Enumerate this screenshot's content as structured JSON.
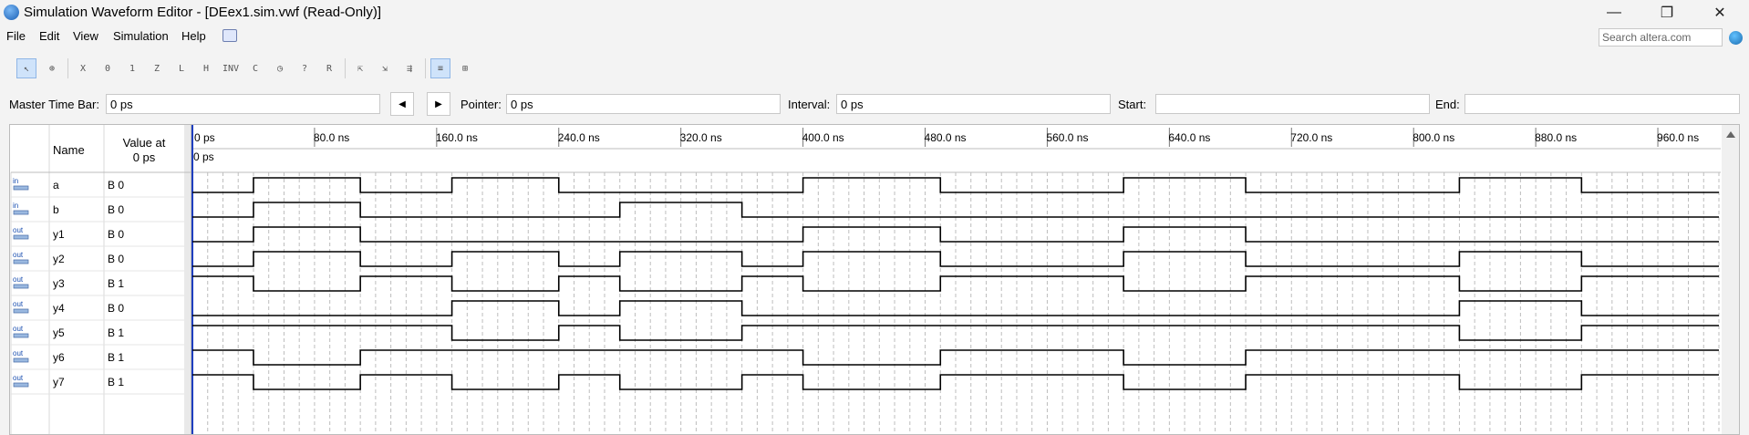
{
  "window": {
    "title": "Simulation Waveform Editor - [DEex1.sim.vwf (Read-Only)]",
    "controls": {
      "minimize": "—",
      "restore": "❐",
      "close": "✕"
    }
  },
  "menu": [
    "File",
    "Edit",
    "View",
    "Simulation",
    "Help"
  ],
  "search": {
    "placeholder": "Search altera.com"
  },
  "toolbar_icons": [
    "selection-tool",
    "zoom-tool",
    "forcing-unknown",
    "forcing-low",
    "forcing-high",
    "high-impedance",
    "weak-low",
    "weak-high",
    "invert",
    "count-value",
    "clock",
    "random-value",
    "arbitrary-value",
    "snap-to-grid",
    "sort",
    "group",
    "ungroup",
    "waveform-view"
  ],
  "timebar": {
    "master_label": "Master Time Bar:",
    "master_value": "0 ps",
    "pointer_label": "Pointer:",
    "pointer_value": "0 ps",
    "interval_label": "Interval:",
    "interval_value": "0 ps",
    "start_label": "Start:",
    "start_value": "",
    "end_label": "End:",
    "end_value": ""
  },
  "table": {
    "name_header": "Name",
    "value_header_1": "Value at",
    "value_header_2": "0 ps"
  },
  "axis": {
    "ticks": [
      "0 ps",
      "80.0 ns",
      "160.0 ns",
      "240.0 ns",
      "320.0 ns",
      "400.0 ns",
      "480.0 ns",
      "560.0 ns",
      "640.0 ns",
      "720.0 ns",
      "800.0 ns",
      "880.0 ns",
      "960.0 ns"
    ],
    "cursor_label": "0 ps",
    "range_ns": [
      0,
      1000
    ]
  },
  "signals": [
    {
      "name": "a",
      "dir": "in",
      "value": "B 0",
      "edges_ns": [
        0,
        40,
        110,
        170,
        240,
        400,
        490,
        610,
        690,
        830,
        910,
        1000
      ],
      "levels": [
        0,
        1,
        0,
        1,
        0,
        1,
        0,
        1,
        0,
        1,
        0
      ]
    },
    {
      "name": "b",
      "dir": "in",
      "value": "B 0",
      "edges_ns": [
        0,
        40,
        110,
        280,
        360,
        1000
      ],
      "levels": [
        0,
        1,
        0,
        1,
        0
      ]
    },
    {
      "name": "y1",
      "dir": "out",
      "value": "B 0",
      "edges_ns": [
        0,
        40,
        110,
        400,
        490,
        610,
        690,
        1000
      ],
      "levels": [
        0,
        1,
        0,
        1,
        0,
        1,
        0
      ]
    },
    {
      "name": "y2",
      "dir": "out",
      "value": "B 0",
      "edges_ns": [
        0,
        40,
        110,
        170,
        240,
        280,
        360,
        400,
        490,
        610,
        690,
        830,
        910,
        1000
      ],
      "levels": [
        0,
        1,
        0,
        1,
        0,
        1,
        0,
        1,
        0,
        1,
        0,
        1,
        0
      ]
    },
    {
      "name": "y3",
      "dir": "out",
      "value": "B 1",
      "edges_ns": [
        0,
        40,
        110,
        170,
        240,
        280,
        360,
        400,
        490,
        610,
        690,
        830,
        910,
        1000
      ],
      "levels": [
        1,
        0,
        1,
        0,
        1,
        0,
        1,
        0,
        1,
        0,
        1,
        0,
        1
      ]
    },
    {
      "name": "y4",
      "dir": "out",
      "value": "B 0",
      "edges_ns": [
        0,
        170,
        240,
        280,
        360,
        830,
        910,
        1000
      ],
      "levels": [
        0,
        1,
        0,
        1,
        0,
        1,
        0
      ]
    },
    {
      "name": "y5",
      "dir": "out",
      "value": "B 1",
      "edges_ns": [
        0,
        170,
        240,
        280,
        360,
        830,
        910,
        1000
      ],
      "levels": [
        1,
        0,
        1,
        0,
        1,
        0,
        1
      ]
    },
    {
      "name": "y6",
      "dir": "out",
      "value": "B 1",
      "edges_ns": [
        0,
        40,
        110,
        400,
        490,
        610,
        690,
        1000
      ],
      "levels": [
        1,
        0,
        1,
        0,
        1,
        0,
        1
      ]
    },
    {
      "name": "y7",
      "dir": "out",
      "value": "B 1",
      "edges_ns": [
        0,
        40,
        110,
        170,
        240,
        280,
        360,
        400,
        490,
        610,
        690,
        830,
        910,
        1000
      ],
      "levels": [
        1,
        0,
        1,
        0,
        1,
        0,
        1,
        0,
        1,
        0,
        1,
        0,
        1
      ]
    }
  ],
  "colors": {
    "cursor": "#1f3fbf",
    "waveform": "#000000",
    "grid": "#bdbdbd"
  }
}
